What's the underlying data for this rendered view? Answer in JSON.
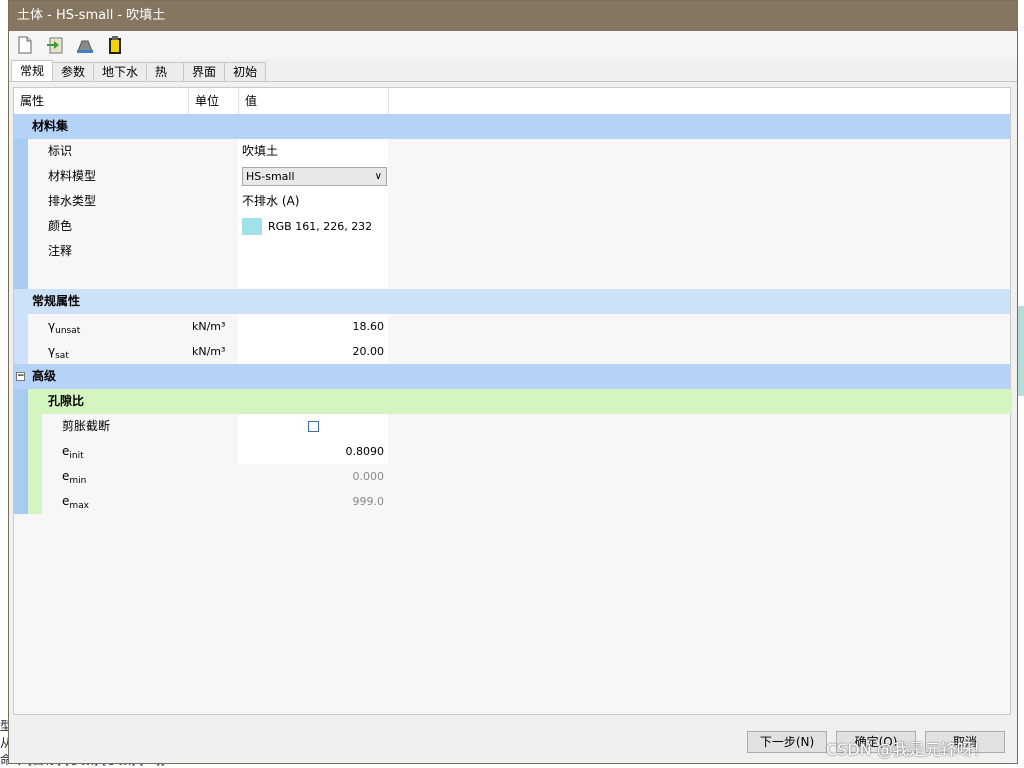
{
  "window": {
    "title": "土体 - HS-small - 吹填土"
  },
  "toolbar": {
    "icons": [
      "new-document-icon",
      "import-icon",
      "soil-database-icon",
      "clipboard-icon"
    ]
  },
  "tabs": [
    {
      "label": "常规",
      "active": true
    },
    {
      "label": "参数",
      "active": false
    },
    {
      "label": "地下水",
      "active": false
    },
    {
      "label": "热",
      "active": false
    },
    {
      "label": "界面",
      "active": false
    },
    {
      "label": "初始",
      "active": false
    }
  ],
  "columns": {
    "property": "属性",
    "unit": "单位",
    "value": "值"
  },
  "material_set": {
    "title": "材料集",
    "identification_label": "标识",
    "identification_value": "吹填土",
    "model_label": "材料模型",
    "model_value": "HS-small",
    "drainage_label": "排水类型",
    "drainage_value": "不排水 (A)",
    "color_label": "颜色",
    "color_value": "RGB 161, 226, 232",
    "color_hex": "#a1e2e8",
    "comment_label": "注释"
  },
  "general": {
    "title": "常规属性",
    "gamma_unsat_symbol": "γ",
    "gamma_unsat_sub": "unsat",
    "gamma_unsat_unit": "kN/m³",
    "gamma_unsat_value": "18.60",
    "gamma_sat_symbol": "γ",
    "gamma_sat_sub": "sat",
    "gamma_sat_unit": "kN/m³",
    "gamma_sat_value": "20.00"
  },
  "advanced": {
    "title": "高级",
    "void_ratio": {
      "title": "孔隙比",
      "dilatancy_cutoff_label": "剪胀截断",
      "dilatancy_cutoff_checked": false,
      "e_init_symbol": "e",
      "e_init_sub": "init",
      "e_init_value": "0.8090",
      "e_min_symbol": "e",
      "e_min_sub": "min",
      "e_min_value": "0.000",
      "e_max_symbol": "e",
      "e_max_sub": "max",
      "e_max_value": "999.0"
    }
  },
  "buttons": {
    "next": "下一步(N)",
    "ok": "确定(O)",
    "cancel": "取消"
  },
  "watermark": "CSDN @我是元锋呀！",
  "background": {
    "line1": "型",
    "line2": "从",
    "line3": "命令 [目标] [参数] [参数] [...]]"
  }
}
